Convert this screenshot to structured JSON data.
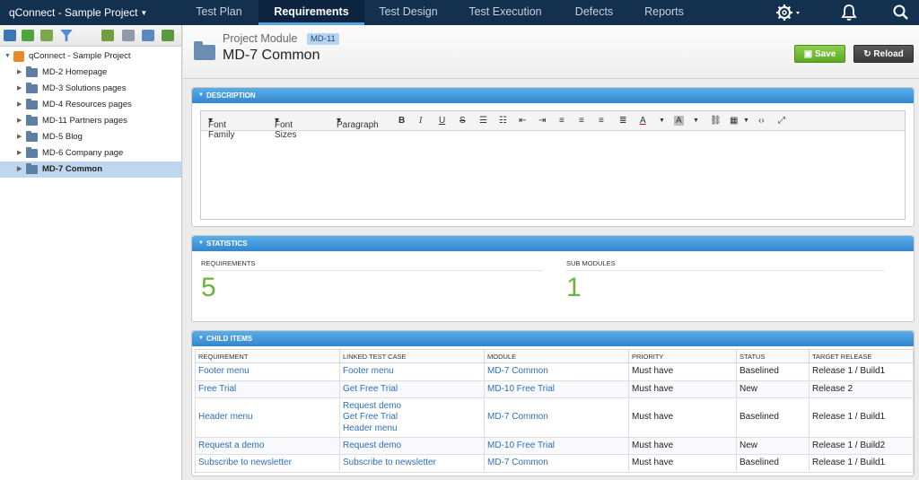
{
  "topbar": {
    "project": "qConnect - Sample Project",
    "nav": [
      {
        "label": "Test Plan",
        "active": false
      },
      {
        "label": "Requirements",
        "active": true
      },
      {
        "label": "Test Design",
        "active": false
      },
      {
        "label": "Test Execution",
        "active": false
      },
      {
        "label": "Defects",
        "active": false
      },
      {
        "label": "Reports",
        "active": false
      }
    ],
    "icons": [
      "gear-icon",
      "bell-icon",
      "search-icon"
    ]
  },
  "tree": {
    "root": "qConnect - Sample Project",
    "items": [
      {
        "label": "MD-2 Homepage",
        "selected": false
      },
      {
        "label": "MD-3 Solutions pages",
        "selected": false
      },
      {
        "label": "MD-4 Resources pages",
        "selected": false
      },
      {
        "label": "MD-11 Partners pages",
        "selected": false
      },
      {
        "label": "MD-5 Blog",
        "selected": false
      },
      {
        "label": "MD-6 Company page",
        "selected": false
      },
      {
        "label": "MD-7 Common",
        "selected": true
      }
    ]
  },
  "header": {
    "module_label": "Project Module",
    "module_id": "MD-11",
    "title": "MD-7 Common",
    "save_label": "Save",
    "reload_label": "Reload"
  },
  "description": {
    "title": "DESCRIPTION",
    "font_family": "Font Family",
    "font_sizes": "Font Sizes",
    "paragraph": "Paragraph",
    "bold": "B",
    "italic": "I",
    "underline": "U",
    "strike": "S",
    "font_color": "A",
    "bg_color": "A"
  },
  "statistics": {
    "title": "STATISTICS",
    "requirements_label": "REQUIREMENTS",
    "requirements_value": "5",
    "submodules_label": "SUB MODULES",
    "submodules_value": "1"
  },
  "child_items": {
    "title": "CHILD ITEMS",
    "columns": [
      "REQUIREMENT",
      "LINKED TEST CASE",
      "MODULE",
      "PRIORITY",
      "STATUS",
      "TARGET RELEASE"
    ],
    "rows": [
      {
        "requirement": "Footer menu",
        "linked": [
          "Footer menu"
        ],
        "module": "MD-7 Common",
        "priority": "Must have",
        "status": "Baselined",
        "release": "Release 1 / Build1"
      },
      {
        "requirement": "Free Trial",
        "linked": [
          "Get Free Trial"
        ],
        "module": "MD-10 Free Trial",
        "priority": "Must have",
        "status": "New",
        "release": "Release 2"
      },
      {
        "requirement": "Header menu",
        "linked": [
          "Request demo",
          "Get Free Trial",
          "Header menu"
        ],
        "module": "MD-7 Common",
        "priority": "Must have",
        "status": "Baselined",
        "release": "Release 1 / Build1"
      },
      {
        "requirement": "Request a demo",
        "linked": [
          "Request demo"
        ],
        "module": "MD-10 Free Trial",
        "priority": "Must have",
        "status": "New",
        "release": "Release 1 / Build2"
      },
      {
        "requirement": "Subscribe to newsletter",
        "linked": [
          "Subscribe to newsletter"
        ],
        "module": "MD-7 Common",
        "priority": "Must have",
        "status": "Baselined",
        "release": "Release 1 / Build1"
      }
    ]
  }
}
